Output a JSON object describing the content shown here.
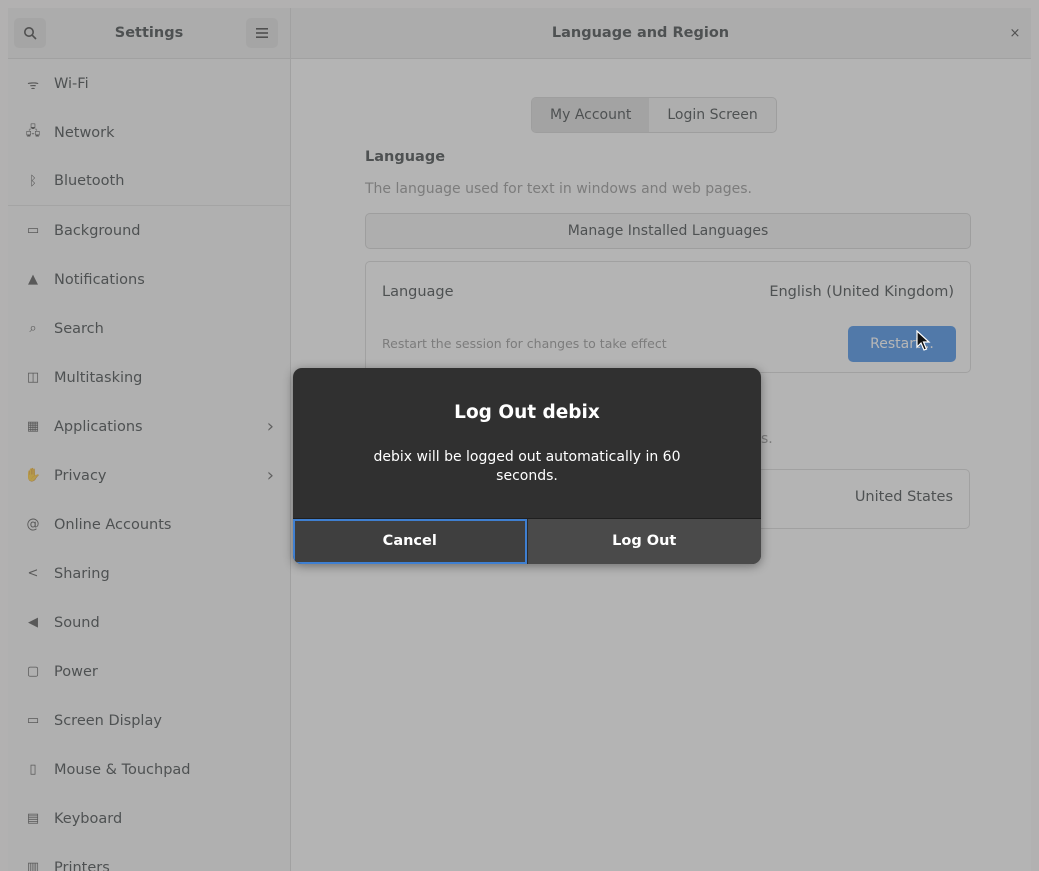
{
  "header": {
    "app_title": "Settings",
    "page_title": "Language and Region",
    "search_icon": "search-icon",
    "menu_icon": "hamburger-menu-icon",
    "close_icon": "close-icon",
    "close_glyph": "×"
  },
  "sidebar": {
    "items": [
      {
        "label": "Wi-Fi",
        "icon": "wifi-icon",
        "glyph": "ᯤ"
      },
      {
        "label": "Network",
        "icon": "network-icon",
        "glyph": "🖧"
      },
      {
        "label": "Bluetooth",
        "icon": "bluetooth-icon",
        "glyph": "ᛒ"
      },
      {
        "label": "Background",
        "icon": "background-icon",
        "glyph": "▭"
      },
      {
        "label": "Notifications",
        "icon": "bell-icon",
        "glyph": "▲"
      },
      {
        "label": "Search",
        "icon": "search-icon",
        "glyph": "⌕"
      },
      {
        "label": "Multitasking",
        "icon": "multitasking-icon",
        "glyph": "◫"
      },
      {
        "label": "Applications",
        "icon": "applications-icon",
        "glyph": "▦",
        "chevron": "›"
      },
      {
        "label": "Privacy",
        "icon": "hand-icon",
        "glyph": "✋",
        "chevron": "›"
      },
      {
        "label": "Online Accounts",
        "icon": "at-icon",
        "glyph": "@"
      },
      {
        "label": "Sharing",
        "icon": "share-icon",
        "glyph": "<"
      },
      {
        "label": "Sound",
        "icon": "speaker-icon",
        "glyph": "◀"
      },
      {
        "label": "Power",
        "icon": "power-icon",
        "glyph": "▢"
      },
      {
        "label": "Screen Display",
        "icon": "display-icon",
        "glyph": "▭"
      },
      {
        "label": "Mouse & Touchpad",
        "icon": "mouse-icon",
        "glyph": "▯"
      },
      {
        "label": "Keyboard",
        "icon": "keyboard-icon",
        "glyph": "▤"
      },
      {
        "label": "Printers",
        "icon": "printer-icon",
        "glyph": "▥"
      }
    ]
  },
  "content": {
    "tabs": [
      {
        "label": "My Account",
        "active": true
      },
      {
        "label": "Login Screen",
        "active": false
      }
    ],
    "language_section": {
      "title": "Language",
      "subtitle": "The language used for text in windows and web pages.",
      "manage_button": "Manage Installed Languages",
      "row_label": "Language",
      "row_value": "English (United Kingdom)",
      "restart_note": "Restart the session for changes to take effect",
      "restart_button": "Restart..."
    },
    "formats_partial_text": "s.",
    "formats_value": "United States"
  },
  "dialog": {
    "title": "Log Out debix",
    "body": "debix will be logged out automatically in 60 seconds.",
    "cancel": "Cancel",
    "logout": "Log Out"
  },
  "colors": {
    "accent": "#3584e4",
    "dialog_bg": "#303030"
  }
}
